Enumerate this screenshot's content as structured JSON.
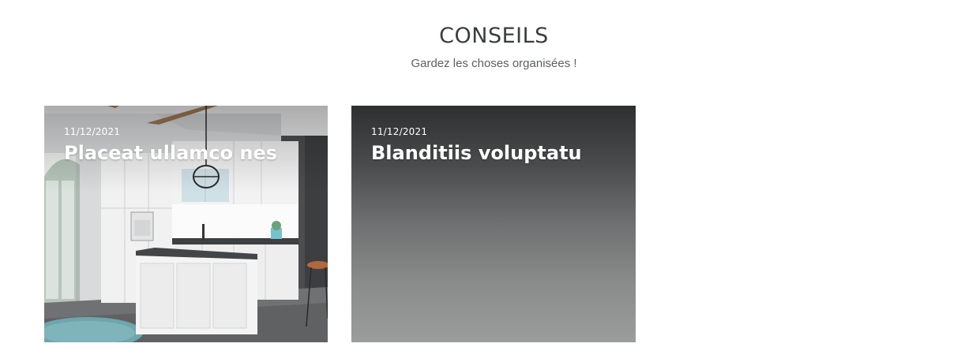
{
  "section": {
    "title": "CONSEILS",
    "subtitle": "Gardez les choses organisées !"
  },
  "cards": [
    {
      "date": "11/12/2021",
      "title": "Placeat ullamco nes",
      "image": "kitchen-photo"
    },
    {
      "date": "11/12/2021",
      "title": "Blanditiis voluptatu",
      "image": "gradient-placeholder"
    }
  ]
}
